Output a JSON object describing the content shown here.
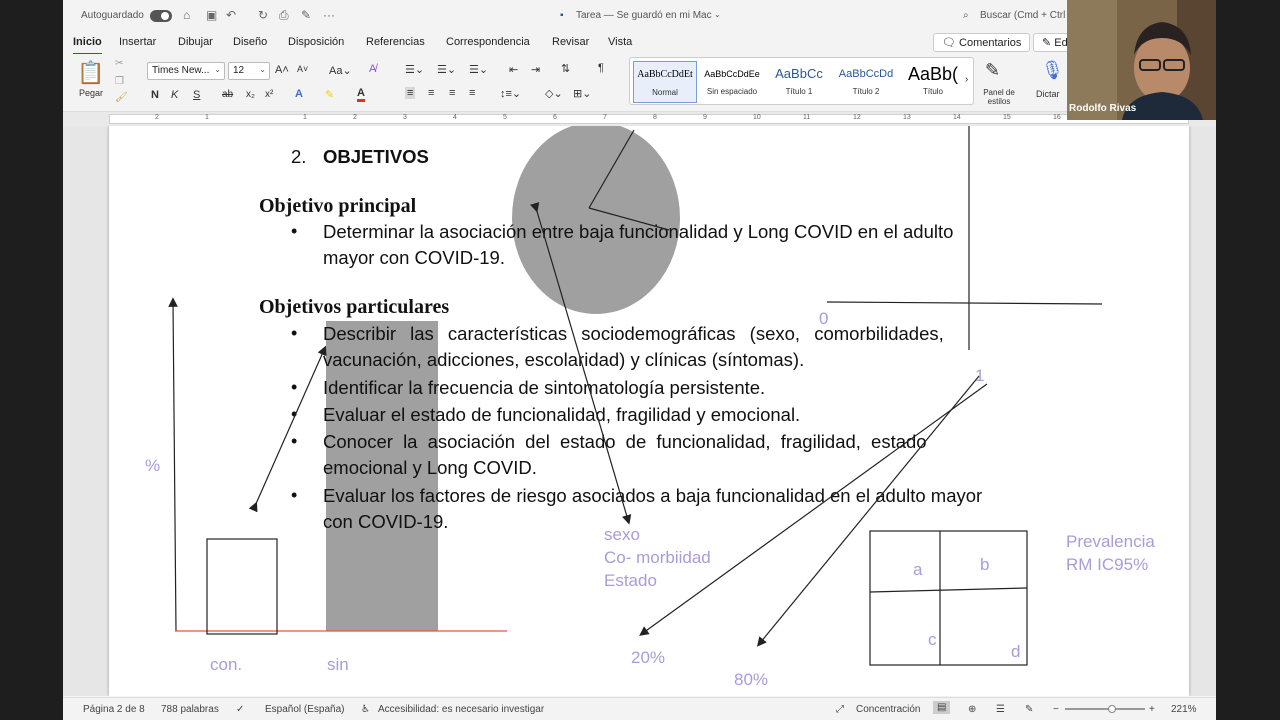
{
  "titlebar": {
    "autosave_label": "Autoguardado",
    "doc_title": "Tarea — Se guardó en mi Mac",
    "search_placeholder": "Buscar (Cmd + Ctrl"
  },
  "tabs": [
    "Inicio",
    "Insertar",
    "Dibujar",
    "Diseño",
    "Disposición",
    "Referencias",
    "Correspondencia",
    "Revisar",
    "Vista"
  ],
  "ribbon": {
    "comments_label": "Comentarios",
    "edit_label": "Ed",
    "paste_label": "Pegar",
    "font_name": "Times New...",
    "font_size": "12",
    "bold": "N",
    "italic": "K",
    "underline": "S",
    "strike": "ab",
    "subscript": "x₂",
    "superscript": "x²",
    "styles": [
      {
        "preview": "AaBbCcDdEt",
        "name": "Normal"
      },
      {
        "preview": "AaBbCcDdEe",
        "name": "Sin espaciado"
      },
      {
        "preview": "AaBbCc",
        "name": "Título 1"
      },
      {
        "preview": "AaBbCcDd",
        "name": "Título 2"
      },
      {
        "preview": "AaBb(",
        "name": "Título"
      }
    ],
    "styles_pane_label": "Panel de estilos",
    "dictate_label": "Dictar"
  },
  "ruler": [
    "2",
    "1",
    "1",
    "2",
    "3",
    "4",
    "5",
    "6",
    "7",
    "8",
    "9",
    "10",
    "11",
    "12",
    "13",
    "14",
    "15",
    "16"
  ],
  "document": {
    "heading_num": "2.",
    "heading": "OBJETIVOS",
    "principal_title": "Objetivo principal",
    "principal_line1": "Determinar la asociación entre baja funcionalidad y Long COVID en el adulto",
    "principal_line2": "mayor con COVID-19.",
    "particulares_title": "Objetivos particulares",
    "p1_line1": "Describir las características sociodemográficas (sexo, comorbilidades,",
    "p1_line2": "vacunación, adicciones, escolaridad) y clínicas (síntomas).",
    "p2": "Identificar la frecuencia de sintomatología persistente.",
    "p3": "Evaluar el estado de funcionalidad, fragilidad y emocional.",
    "p4_line1": "Conocer la asociación del estado de funcionalidad, fragilidad, estado",
    "p4_line2": "emocional y Long COVID.",
    "p5_line1": "Evaluar los factores de riesgo asociados a baja funcionalidad en el adulto mayor",
    "p5_line2": "con COVID-19."
  },
  "annotations": {
    "percent": "%",
    "con": "con.",
    "sin": "sin",
    "zero": "0",
    "one": "1",
    "sexo": "sexo",
    "comorbidad": "Co- morbiidad",
    "estado": "Estado",
    "p20": "20%",
    "p80": "80%",
    "a": "a",
    "b": "b",
    "c": "c",
    "d": "d",
    "prevalencia": "Prevalencia",
    "rm": "RM IC95%"
  },
  "statusbar": {
    "page": "Página 2 de 8",
    "words": "788 palabras",
    "language": "Español (España)",
    "accessibility": "Accesibilidad: es necesario investigar",
    "focus": "Concentración",
    "zoom": "221%"
  },
  "video": {
    "name": "Rodolfo Rivas"
  },
  "colors": {
    "accent": "#2b579a",
    "ink": "#a99cd9",
    "highlight": "#a0a0a0",
    "underline_red": "#e05a3a"
  }
}
